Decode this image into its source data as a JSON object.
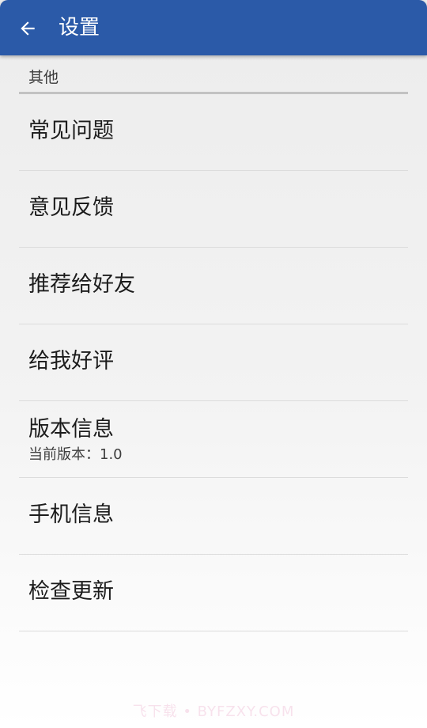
{
  "appbar": {
    "title": "设置"
  },
  "section": {
    "header": "其他"
  },
  "items": [
    {
      "label": "常见问题"
    },
    {
      "label": "意见反馈"
    },
    {
      "label": "推荐给好友"
    },
    {
      "label": "给我好评"
    },
    {
      "label": "版本信息",
      "sublabel": "当前版本：1.0"
    },
    {
      "label": "手机信息"
    },
    {
      "label": "检查更新"
    }
  ],
  "watermark": "飞下载 • BYFZXY.COM",
  "colors": {
    "appbar": "#2b5aa8",
    "divider": "#dcdcdc",
    "section_divider": "#c2c2c2"
  },
  "icons": {
    "back": "arrow-left-icon"
  }
}
